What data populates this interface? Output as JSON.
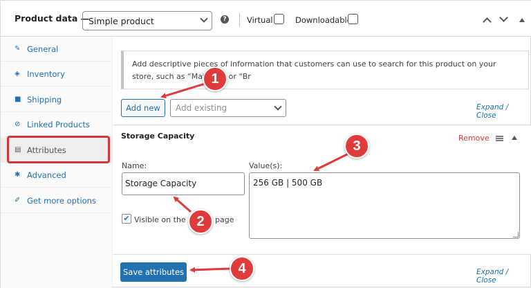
{
  "header": {
    "title": "Product data —",
    "product_type": "Simple product",
    "help_icon": "question-icon",
    "virtual_label": "Virtual:",
    "downloadable_label": "Downloadable:"
  },
  "sidebar": {
    "items": [
      {
        "label": "General",
        "icon": "wrench-icon"
      },
      {
        "label": "Inventory",
        "icon": "tag-icon"
      },
      {
        "label": "Shipping",
        "icon": "truck-icon"
      },
      {
        "label": "Linked Products",
        "icon": "link-icon"
      },
      {
        "label": "Attributes",
        "icon": "list-card-icon"
      },
      {
        "label": "Advanced",
        "icon": "gear-icon"
      },
      {
        "label": "Get more options",
        "icon": "plugin-icon"
      }
    ]
  },
  "notice": {
    "text": "Add descriptive pieces of information that customers can use to search for this product on your store, such as “Material” or “Br"
  },
  "toolbar": {
    "add_new": "Add new",
    "add_existing_placeholder": "Add existing",
    "expand_close": "Expand / Close"
  },
  "attribute": {
    "title": "Storage Capacity",
    "remove": "Remove",
    "name_label": "Name:",
    "name_value": "Storage Capacity",
    "values_label": "Value(s):",
    "values_value": "256 GB | 500 GB",
    "visible_label": "Visible on the pr"
  },
  "visible_label_tail": "page",
  "footer": {
    "save": "Save attributes",
    "expand_close": "Expand / Close"
  },
  "callouts": [
    "1",
    "2",
    "3",
    "4"
  ],
  "colors": {
    "accent": "#2271b1",
    "callout": "#e03b3b",
    "remove": "#d63638"
  }
}
